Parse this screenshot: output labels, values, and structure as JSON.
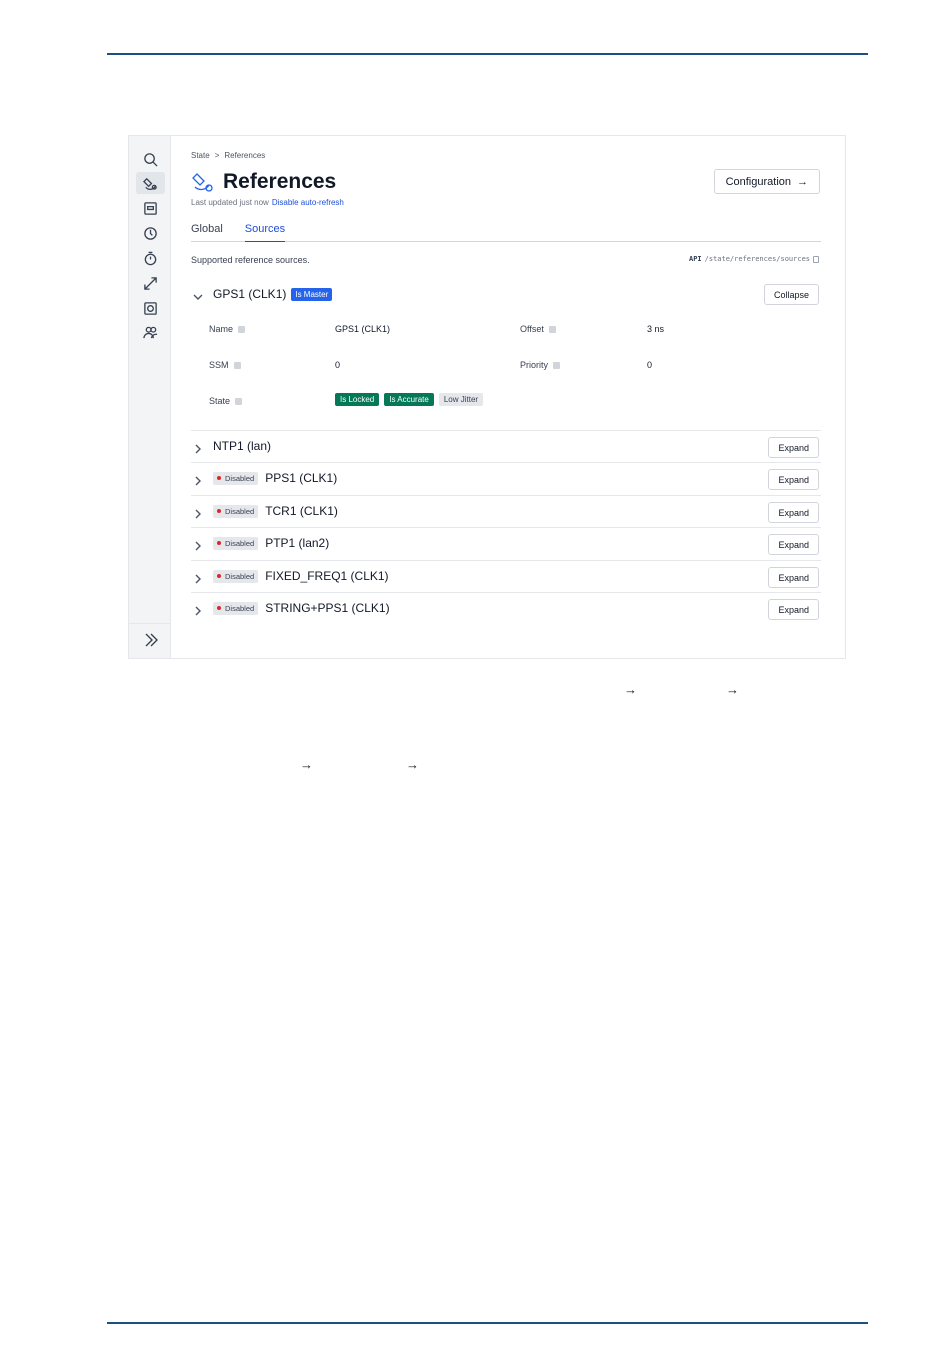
{
  "breadcrumb": {
    "root": "State",
    "sep": ">",
    "current": "References"
  },
  "header": {
    "title": "References",
    "updated_text": "Last updated just now",
    "auto_refresh_link": "Disable auto-refresh",
    "config_button": "Configuration",
    "config_arrow": "→"
  },
  "tabs": [
    {
      "label": "Global",
      "active": false
    },
    {
      "label": "Sources",
      "active": true
    }
  ],
  "supported_text": "Supported reference sources.",
  "api": {
    "label": "API",
    "path": "/state/references/sources"
  },
  "gps": {
    "name": "GPS1 (CLK1)",
    "badge": "Is Master",
    "button": "Collapse",
    "fields": {
      "name_label": "Name",
      "name_value": "GPS1 (CLK1)",
      "offset_label": "Offset",
      "offset_value": "3 ns",
      "ssm_label": "SSM",
      "ssm_value": "0",
      "priority_label": "Priority",
      "priority_value": "0",
      "state_label": "State"
    },
    "state_badges": [
      "Is Locked",
      "Is Accurate",
      "Low Jitter"
    ]
  },
  "sources": [
    {
      "name": "NTP1 (lan)",
      "disabled": false,
      "button": "Expand"
    },
    {
      "name": "PPS1 (CLK1)",
      "disabled": true,
      "button": "Expand"
    },
    {
      "name": "TCR1 (CLK1)",
      "disabled": true,
      "button": "Expand"
    },
    {
      "name": "PTP1 (lan2)",
      "disabled": true,
      "button": "Expand"
    },
    {
      "name": "FIXED_FREQ1 (CLK1)",
      "disabled": true,
      "button": "Expand"
    },
    {
      "name": "STRING+PPS1 (CLK1)",
      "disabled": true,
      "button": "Expand"
    }
  ],
  "disabled_label": "Disabled",
  "doc_arrows": [
    "→",
    "→",
    "→",
    "→"
  ],
  "colors": {
    "rule": "#1d4f86",
    "accent": "#2563eb",
    "success": "#047857",
    "danger": "#dc2626"
  }
}
